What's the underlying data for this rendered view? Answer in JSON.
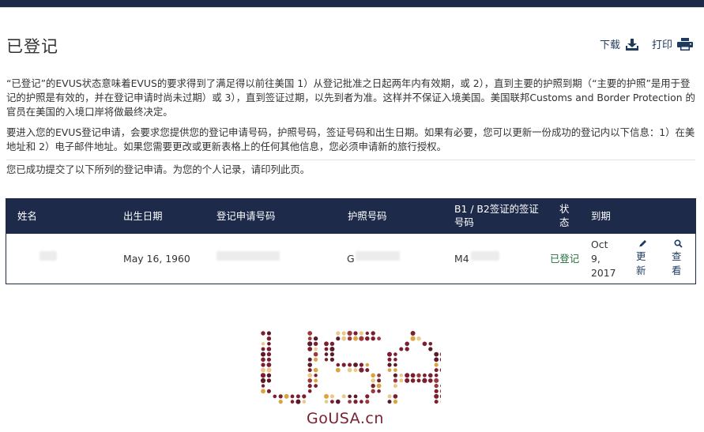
{
  "header": {
    "title": "已登记",
    "download_label": "下载",
    "print_label": "打印"
  },
  "info": {
    "p1": "“已登记”的EVUS状态意味着EVUS的要求得到了满足得以前往美国 1）从登记批准之日起两年内有效期，或 2），直到主要的护照到期（“主要的护照”是用于登记的护照是有效的，并在登记申请时尚未过期）或 3），直到签证过期，以先到者为准。这样并不保证入境美国。美国联邦Customs and Border Protection 的官员在美国的入境口岸将做最终决定。",
    "p2": "要进入您的EVUS登记申请，会要求您提供您的登记申请号码，护照号码，签证号码和出生日期。如果有必要，您可以更新一份成功的登记内以下信息：1）在美地址和 2）电子邮件地址。如果您需要更改或更新表格上的任何其他信息，您必须申请新的旅行授权。",
    "p3": "您已成功提交了以下所列的登记申请。为您的个人记录，请印列此页。"
  },
  "table": {
    "headers": {
      "name": "姓名",
      "dob": "出生日期",
      "app_no": "登记申请号码",
      "passport": "护照号码",
      "visa": "B1 / B2签证的签证号码",
      "status": "状态",
      "expires": "到期"
    },
    "rows": [
      {
        "dob": "May 16, 1960",
        "passport_prefix": "G",
        "visa_prefix": "M4",
        "status": "已登记",
        "expires": "Oct 9, 2017",
        "update_label": "更新",
        "view_label": "查看"
      }
    ]
  },
  "footer": {
    "logo_text": "USA",
    "brand": "GoUSA.cn"
  },
  "colors": {
    "navy": "#1e2a4a",
    "link": "#1e3a5f",
    "status_green": "#1f6f3a",
    "brand_maroon": "#7a1f2f",
    "brand_gold": "#d9a441"
  }
}
